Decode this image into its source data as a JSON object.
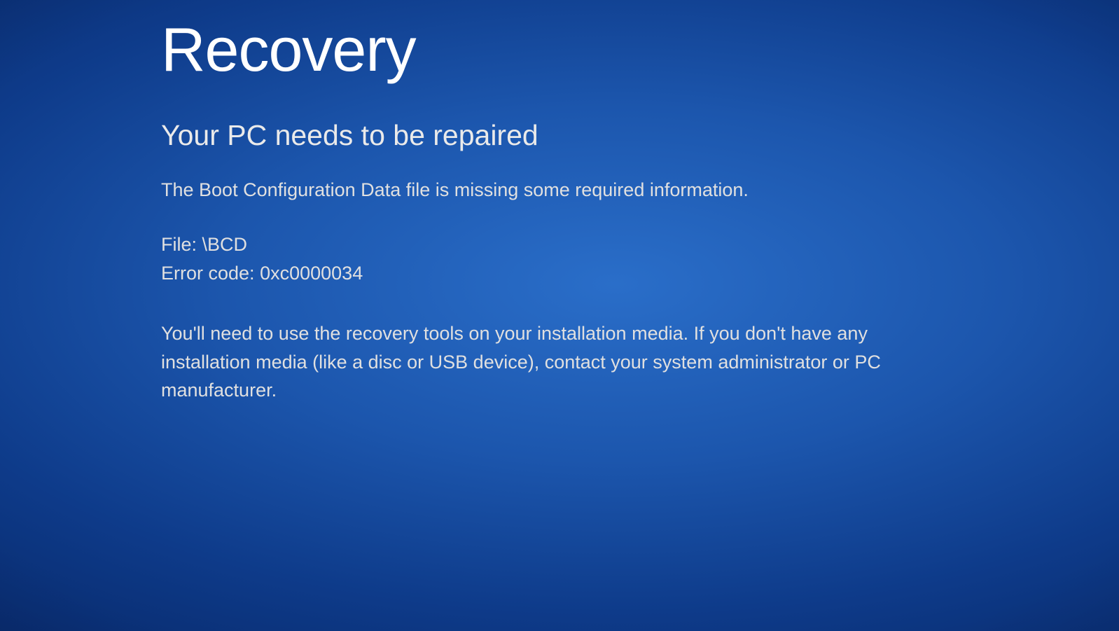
{
  "recovery": {
    "title": "Recovery",
    "subtitle": "Your PC needs to be repaired",
    "description": "The Boot Configuration Data file is missing some required information.",
    "file_label": "File:",
    "file_value": "\\BCD",
    "error_code_label": "Error code:",
    "error_code_value": "0xc0000034",
    "instructions": "You'll need to use the recovery tools on your installation media. If you don't have any installation media (like a disc or USB device), contact your system administrator or PC manufacturer."
  }
}
